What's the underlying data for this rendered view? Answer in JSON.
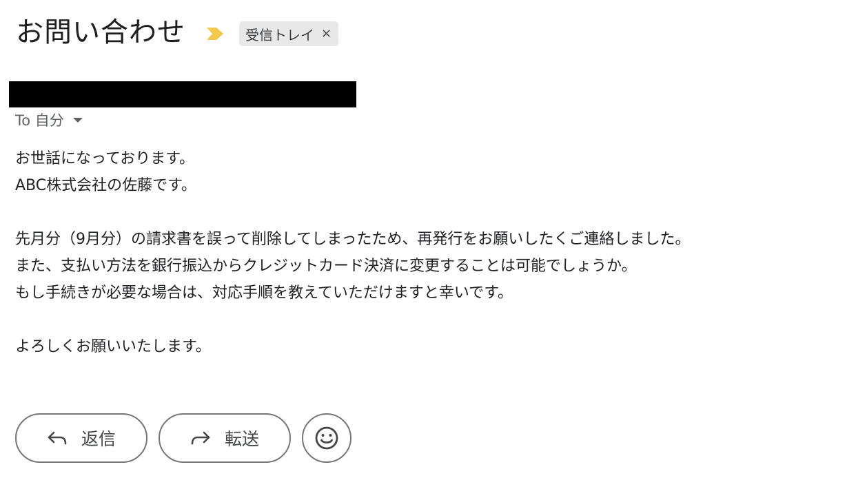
{
  "header": {
    "subject": "お問い合わせ",
    "importance_icon": "importance-marker-icon",
    "importance_color": "#f2c94c",
    "label": {
      "text": "受信トレイ",
      "close": "×"
    }
  },
  "recipient": {
    "text": "To 自分"
  },
  "body": {
    "lines": [
      "お世話になっております。",
      "ABC株式会社の佐藤です。",
      "",
      "先月分（9月分）の請求書を誤って削除してしまったため、再発行をお願いしたくご連絡しました。",
      "また、支払い方法を銀行振込からクレジットカード決済に変更することは可能でしょうか。",
      "もし手続きが必要な場合は、対応手順を教えていただけますと幸いです。",
      "",
      "よろしくお願いいたします。"
    ]
  },
  "actions": {
    "reply_label": "返信",
    "forward_label": "転送",
    "reply_icon": "reply-icon",
    "forward_icon": "forward-icon",
    "emoji_icon": "smiley-icon"
  }
}
